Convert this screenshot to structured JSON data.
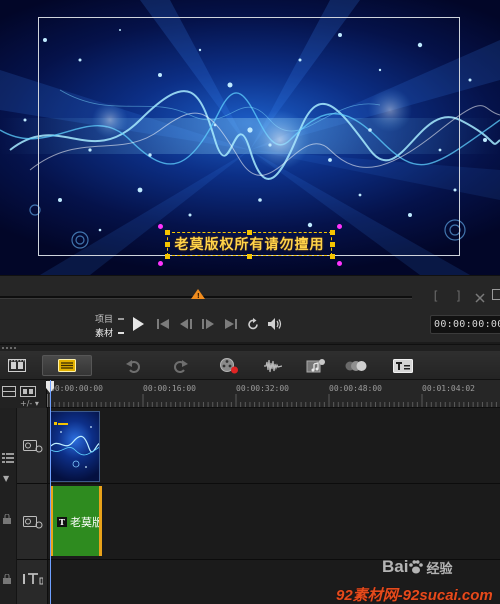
{
  "preview": {
    "title_text": "老莫版权所有请勿擅用"
  },
  "player": {
    "mode_project": "项目",
    "mode_clip": "素材",
    "mark_in": "[",
    "mark_out": "]",
    "timecode": "00:00:00:00",
    "scrub_position": 0.48
  },
  "toolbar": {
    "buttons": [
      "storyboard-view-icon",
      "timeline-view-icon",
      "undo-icon",
      "redo-icon",
      "record-capture-icon",
      "sound-mixer-icon",
      "auto-music-icon",
      "motion-tracking-icon",
      "subtitle-editor-icon"
    ]
  },
  "ruler": {
    "labels": [
      "00:00:00:00",
      "00:00:16:00",
      "00:00:32:00",
      "00:00:48:00",
      "00:01:04:02"
    ]
  },
  "tracks": {
    "title_clip_text": "老莫版"
  },
  "watermarks": {
    "baidu_brand": "Bai",
    "baidu_jingyan": "经验",
    "site": "92素材网-92sucai.com"
  },
  "colors": {
    "accent_orange": "#f08c1e",
    "title_yellow": "#ffd34a",
    "title_clip_green": "#2e8b1f"
  }
}
